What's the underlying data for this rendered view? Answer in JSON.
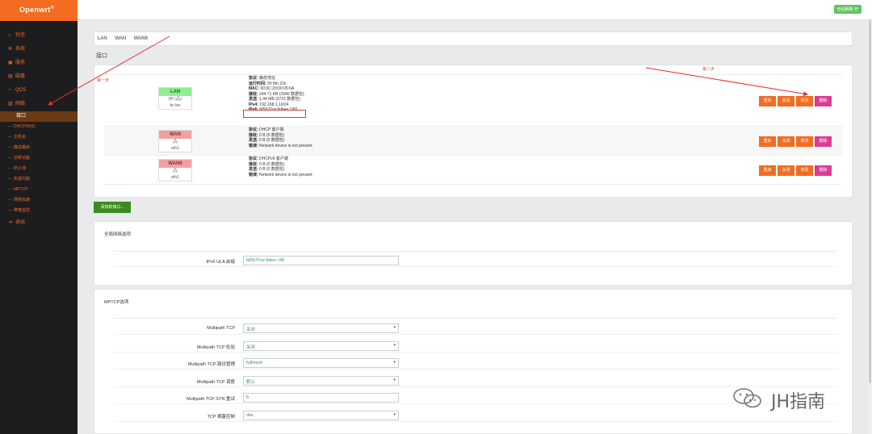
{
  "app": {
    "logo": "Openwrt",
    "logo_mark": "®",
    "auto_refresh": "自动刷新 开"
  },
  "sidebar": {
    "items": [
      {
        "icon": "home-icon",
        "glyph": "⌂",
        "label": "状态"
      },
      {
        "icon": "wrench-icon",
        "glyph": "✲",
        "label": "系统"
      },
      {
        "icon": "briefcase-icon",
        "glyph": "▣",
        "label": "服务"
      },
      {
        "icon": "disk-icon",
        "glyph": "▤",
        "label": "磁盘"
      },
      {
        "icon": "qos-icon",
        "glyph": "◔",
        "label": "QOS"
      },
      {
        "icon": "network-icon",
        "glyph": "▥",
        "label": "网络"
      }
    ],
    "active": "接口",
    "subitems": [
      "DHCP/DNS",
      "主机名",
      "静态路由",
      "诊断功能",
      "防火墙",
      "负载均衡",
      "MPTCP",
      "网络加速",
      "带宽监控"
    ],
    "logout": {
      "icon": "logout-icon",
      "glyph": "⇥",
      "label": "退出"
    }
  },
  "tabs": [
    "LAN",
    "WAN",
    "WAN6"
  ],
  "section_title": "接口",
  "annotations": {
    "step1": "第一步",
    "step2": "第二步"
  },
  "interfaces": [
    {
      "name": "LAN",
      "kind": "lan",
      "icon_text": "8P (🖧)",
      "device": "br-lan",
      "lines": [
        {
          "k": "协议:",
          "v": " 静态地址"
        },
        {
          "k": "运行时间:",
          "v": " 0h 8m 23s"
        },
        {
          "k": "MAC:",
          "v": " 00:0C:29:00:05:6A"
        },
        {
          "k": "接收:",
          "v": " 244.71 KB (2940 数据包)"
        },
        {
          "k": "发送:",
          "v": " 1.44 MB (2715 数据包)"
        },
        {
          "k": "IPv4:",
          "v": " 192.168.1.10/24"
        },
        {
          "k": "IPv6:",
          "v": " fd59:f7ce:9dbee:1/60"
        }
      ]
    },
    {
      "name": "WAN",
      "kind": "wan",
      "icon_text": "🖧",
      "device": "eth1",
      "lines": [
        {
          "k": "协议:",
          "v": " DHCP 客户端"
        },
        {
          "k": "接收:",
          "v": " 0 B (0 数据包)"
        },
        {
          "k": "发送:",
          "v": " 0 B (0 数据包)"
        },
        {
          "k": "错误:",
          "v": " Network device is not present"
        }
      ]
    },
    {
      "name": "WAN6",
      "kind": "wan",
      "icon_text": "🖧",
      "device": "eth1",
      "lines": [
        {
          "k": "协议:",
          "v": " DHCPv6 客户端"
        },
        {
          "k": "接收:",
          "v": " 0 B (0 数据包)"
        },
        {
          "k": "发送:",
          "v": " 0 B (0 数据包)"
        },
        {
          "k": "错误:",
          "v": " Network device is not present"
        }
      ]
    }
  ],
  "buttons": {
    "restart": "重启",
    "stop": "关闭",
    "edit": "修改",
    "delete": "删除"
  },
  "add_button": "添加新接口...",
  "global": {
    "title": "全局网络选项",
    "ula_label": "IPv6 ULA 前缀",
    "ula_value": "fd59:f7ce:9dee::/48"
  },
  "mptcp": {
    "title": "MPTCP选项",
    "fields": [
      {
        "label": "Multipath TCP",
        "value": "关闭",
        "select": true
      },
      {
        "label": "Multipath TCP 检验",
        "value": "关闭",
        "select": true
      },
      {
        "label": "Multipath TCP 路径管理",
        "value": "fullmesh",
        "select": true
      },
      {
        "label": "Multipath TCP 调度",
        "value": "默认",
        "select": true
      },
      {
        "label": "Multipath TCP SYN 重试",
        "value": "5",
        "select": false
      },
      {
        "label": "TCP 拥塞控制",
        "value": "olia",
        "select": true
      }
    ]
  },
  "watermark": "JH指南",
  "colors": {
    "accent": "#f36c21",
    "delete": "#dc3b97",
    "add": "#3b8c1e",
    "lan": "#90ee90",
    "wan": "#f1a1a1",
    "annotation": "#d9534f"
  }
}
